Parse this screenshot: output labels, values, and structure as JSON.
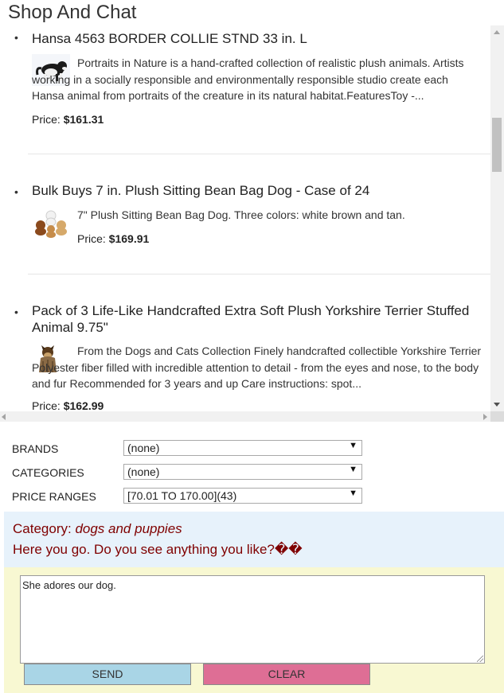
{
  "app": {
    "title": "Shop And Chat"
  },
  "products": [
    {
      "bullet": "•",
      "title": "Hansa 4563 BORDER COLLIE STND 33 in. L",
      "description": "Portraits in Nature is a hand-crafted collection of realistic plush animals. Artists working in a socially responsible and environmentally responsible studio create each Hansa animal from portraits of the creature in its natural habitat.FeaturesToy -...",
      "price_label": "Price:",
      "price": "$161.31",
      "image_icon": "border-collie-plush-image"
    },
    {
      "bullet": "•",
      "title": "Bulk Buys 7 in. Plush Sitting Bean Bag Dog - Case of 24",
      "description": "7\" Plush Sitting Bean Bag Dog. Three colors: white brown and tan.",
      "price_label": "Price:",
      "price": "$169.91",
      "image_icon": "bean-bag-dogs-image"
    },
    {
      "bullet": "•",
      "title": "Pack of 3 Life-Like Handcrafted Extra Soft Plush Yorkshire Terrier Stuffed Animal 9.75\"",
      "description": "From the Dogs and Cats Collection Finely handcrafted collectible Yorkshire Terrier Polyester fiber filled with incredible attention to detail - from the eyes and nose, to the body and fur Recommended for 3 years and up Care instructions: spot...",
      "price_label": "Price:",
      "price": "$162.99",
      "image_icon": "yorkshire-terrier-plush-image"
    }
  ],
  "filters": {
    "brands": {
      "label": "BRANDS",
      "selected": "(none)"
    },
    "categories": {
      "label": "CATEGORIES",
      "selected": "(none)"
    },
    "price_ranges": {
      "label": "PRICE RANGES",
      "selected": "[70.01 TO 170.00](43)"
    }
  },
  "chat": {
    "category_label": "Category:",
    "category_value": "dogs and puppies",
    "message": "Here you go. Do you see anything you like?��"
  },
  "input": {
    "value": "She adores our dog.",
    "send_label": "SEND",
    "clear_label": "CLEAR"
  },
  "colors": {
    "chat_bg": "#e7f2fb",
    "chat_text": "#7f0000",
    "input_bg": "#f8f8d2",
    "send_bg": "#a9d5e6",
    "clear_bg": "#de6e95"
  }
}
